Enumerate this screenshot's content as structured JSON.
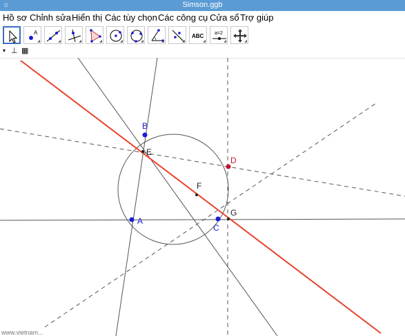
{
  "window": {
    "title": "Simson.ggb",
    "app_icon": "geogebra-icon"
  },
  "menu": [
    {
      "label": "Hồ sơ"
    },
    {
      "label": "Chỉnh sửa"
    },
    {
      "label": "Hiển thị"
    },
    {
      "label": "Các tùy chọn"
    },
    {
      "label": "Các công cụ"
    },
    {
      "label": "Cửa sổ"
    },
    {
      "label": "Trợ giúp"
    }
  ],
  "toolbar": {
    "tools": [
      {
        "icon": "move-arrow-icon",
        "active": true
      },
      {
        "icon": "point-icon"
      },
      {
        "icon": "line-through-two-points-icon"
      },
      {
        "icon": "perpendicular-line-icon"
      },
      {
        "icon": "polygon-icon"
      },
      {
        "icon": "circle-center-point-icon"
      },
      {
        "icon": "circle-three-points-icon"
      },
      {
        "icon": "angle-icon"
      },
      {
        "icon": "reflect-about-line-icon"
      },
      {
        "icon": "text-icon",
        "text": "ABC"
      },
      {
        "icon": "slider-icon",
        "text": "a=2"
      },
      {
        "icon": "move-graphics-view-icon"
      }
    ]
  },
  "stylebar": {
    "items": [
      "toggle-stylebar-icon",
      "axes-icon",
      "grid-icon"
    ]
  },
  "graphics": {
    "colors": {
      "point_blue": "#1a1ad8",
      "point_red": "#c8102e",
      "line_red": "#e8412c",
      "line_gray": "#555555",
      "dashed": "#555555"
    },
    "points": [
      {
        "name": "A",
        "color": "blue"
      },
      {
        "name": "B",
        "color": "blue"
      },
      {
        "name": "C",
        "color": "blue"
      },
      {
        "name": "D",
        "color": "red"
      },
      {
        "name": "E",
        "color": "black"
      },
      {
        "name": "F",
        "color": "black"
      },
      {
        "name": "G",
        "color": "black"
      }
    ],
    "bottom_text": "www.vietnam..."
  }
}
